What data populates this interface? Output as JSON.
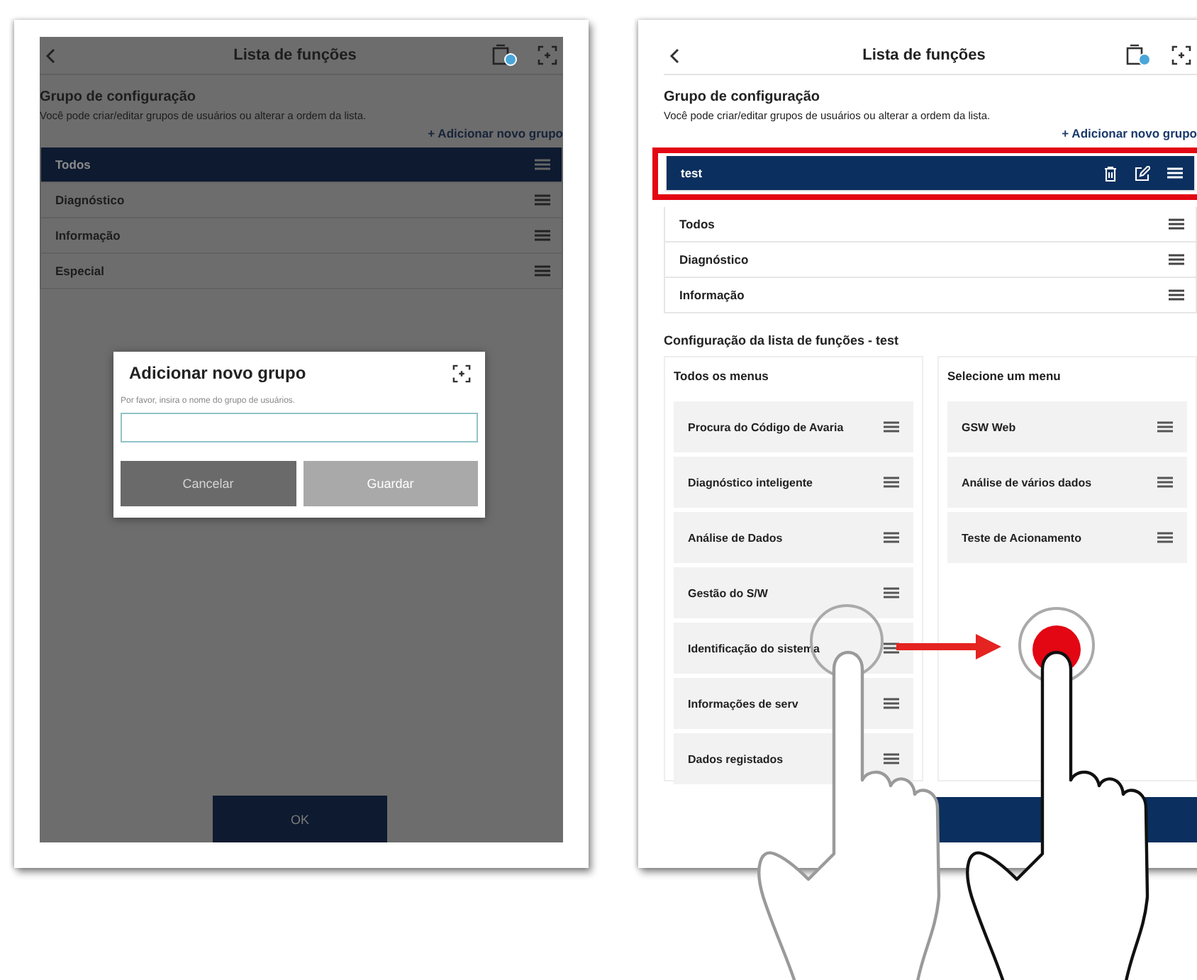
{
  "left_screen": {
    "title": "Lista de funções",
    "section_title": "Grupo de configuração",
    "description": "Você pode criar/editar grupos de usuários ou alterar a ordem da lista.",
    "add_link": "+ Adicionar novo grupo",
    "groups": [
      {
        "label": "Todos",
        "selected": true
      },
      {
        "label": "Diagnóstico",
        "selected": false
      },
      {
        "label": "Informação",
        "selected": false
      },
      {
        "label": "Especial",
        "selected": false
      }
    ],
    "dialog": {
      "title": "Adicionar novo grupo",
      "prompt": "Por favor, insira o nome do grupo de usuários.",
      "buttons": [
        {
          "label": "Cancelar",
          "disabled": false
        },
        {
          "label": "Guardar",
          "disabled": true
        }
      ]
    },
    "ok_button": "OK"
  },
  "right_screen": {
    "title": "Lista de funções",
    "section_title": "Grupo de configuração",
    "description": "Você pode criar/editar grupos de usuários ou alterar a ordem da lista.",
    "add_link": "+ Adicionar novo grupo",
    "groups": [
      {
        "label": "test",
        "selected": true
      },
      {
        "label": "Todos",
        "selected": false
      },
      {
        "label": "Diagnóstico",
        "selected": false
      },
      {
        "label": "Informação",
        "selected": false
      }
    ],
    "config_title": "Configuração da lista de funções - test",
    "all_menus": {
      "title": "Todos os menus",
      "items": [
        "Procura do Código de Avaria",
        "Diagnóstico inteligente",
        "Análise de Dados",
        "Gestão do S/W",
        "Identificação do sistema",
        "Informações de serv",
        "Dados registados"
      ]
    },
    "selected_menus": {
      "title": "Selecione um menu",
      "items": [
        "GSW Web",
        "Análise de vários dados",
        "Teste de Acionamento"
      ]
    }
  }
}
